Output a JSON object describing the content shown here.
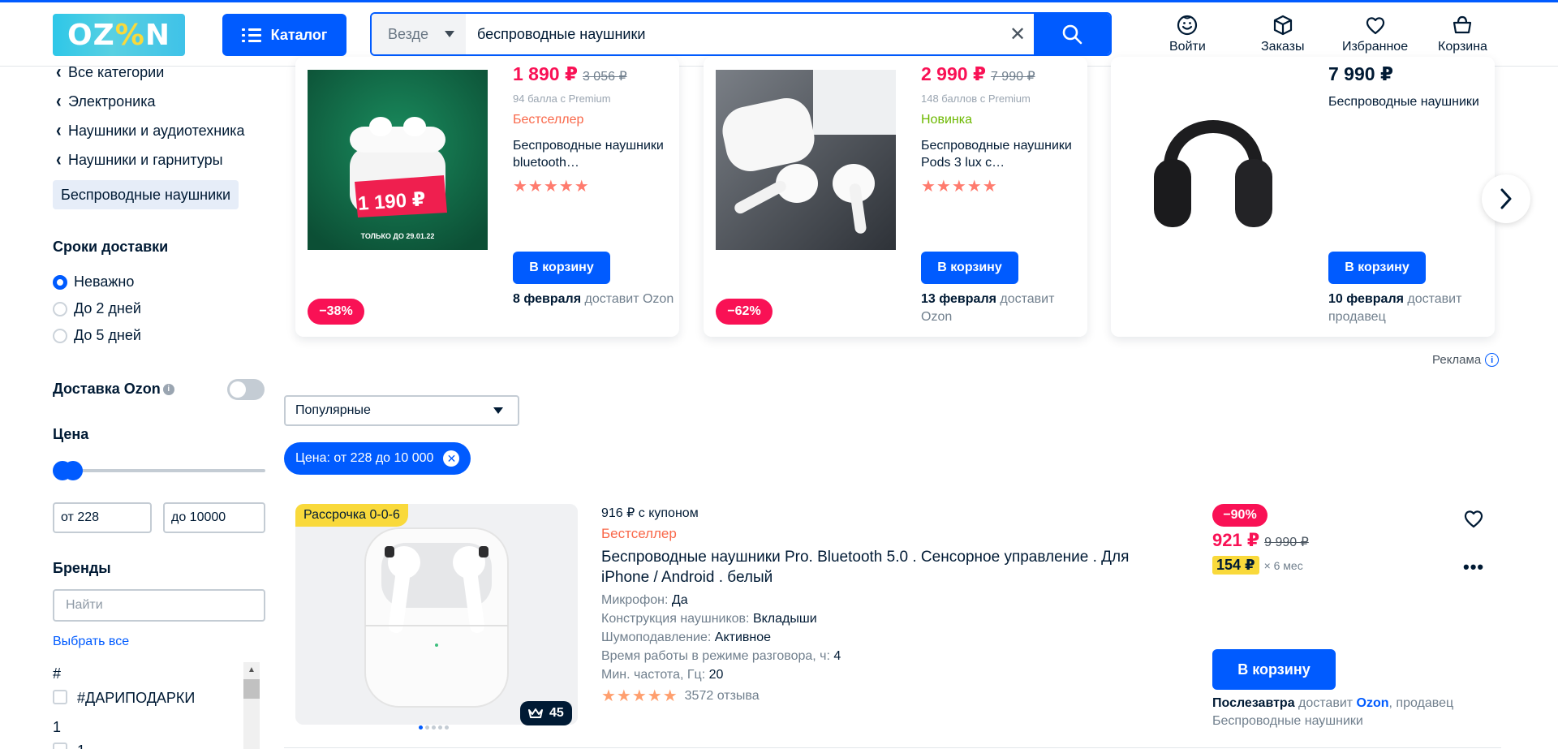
{
  "header": {
    "logo": "OZ%N",
    "catalog_label": "Каталог",
    "search_scope": "Везде",
    "search_query": "беспроводные наушники",
    "clear_symbol": "✕",
    "items": [
      {
        "label": "Войти",
        "icon": "user-face-icon"
      },
      {
        "label": "Заказы",
        "icon": "box-icon"
      },
      {
        "label": "Избранное",
        "icon": "heart-icon"
      },
      {
        "label": "Корзина",
        "icon": "basket-icon"
      }
    ]
  },
  "sidebar": {
    "breadcrumbs": [
      "Все категории",
      "Электроника",
      "Наушники и аудиотехника",
      "Наушники и гарнитуры"
    ],
    "current_category": "Беспроводные наушники",
    "delivery_title": "Сроки доставки",
    "delivery_options": [
      {
        "label": "Неважно",
        "selected": true
      },
      {
        "label": "До 2 дней",
        "selected": false
      },
      {
        "label": "До 5 дней",
        "selected": false
      }
    ],
    "ozon_delivery_label": "Доставка Ozon",
    "ozon_delivery_enabled": false,
    "price_title": "Цена",
    "price_from": "от 228",
    "price_to": "до 10000",
    "brands_title": "Бренды",
    "brands_search_placeholder": "Найти",
    "select_all": "Выбрать все",
    "brand_groups": [
      {
        "letter": "#",
        "items": [
          "#ДАРИПОДАРКИ"
        ]
      },
      {
        "letter": "1",
        "items": [
          "1"
        ]
      }
    ]
  },
  "ads": [
    {
      "price": "1 890 ₽",
      "old_price": "3 056 ₽",
      "points": "94 балла с Premium",
      "badge": "Бестселлер",
      "badge_color": "#f9684a",
      "title": "Беспроводные наушники bluetooth…",
      "rating": 5,
      "stars": "★★★★★",
      "cart": "В корзину",
      "delivery_date": "8 февраля",
      "delivery_rest": " доставит Ozon",
      "discount": "−38%",
      "image_price": "1 190 ₽",
      "image_caption": "ТОЛЬКО ДО 29.01.22"
    },
    {
      "price": "2 990 ₽",
      "old_price": "7 990 ₽",
      "points": "148 баллов с Premium",
      "badge": "Новинка",
      "badge_color": "#6cb800",
      "title": "Беспроводные наушники Pods 3 lux с…",
      "rating": 5,
      "stars": "★★★★★",
      "cart": "В корзину",
      "delivery_date": "13 февраля",
      "delivery_rest": " доставит Ozon",
      "discount": "−62%"
    },
    {
      "price": "7 990 ₽",
      "title": "Беспроводные наушники",
      "cart": "В корзину",
      "delivery_date": "10 февраля",
      "delivery_rest": " доставит продавец"
    }
  ],
  "ads_label": "Реклама",
  "sort": {
    "selected": "Популярные"
  },
  "active_filter": "Цена: от 228 до 10 000",
  "product": {
    "installment_badge": "Рассрочка 0-0-6",
    "premium_count": "45",
    "coupon": "916 ₽ с купоном",
    "badge": "Бестселлер",
    "title": "Беспроводные наушники Pro. Bluetooth 5.0 . Сенсорное управление . Для iPhone / Android . белый",
    "attributes": [
      {
        "name": "Микрофон: ",
        "value": "Да"
      },
      {
        "name": "Конструкция наушников: ",
        "value": "Вкладыши"
      },
      {
        "name": "Шумоподавление: ",
        "value": "Активное"
      },
      {
        "name": "Время работы в режиме разговора, ч: ",
        "value": "4"
      },
      {
        "name": "Мин. частота, Гц: ",
        "value": "20"
      }
    ],
    "rating": 4.5,
    "stars": "★★★★★",
    "reviews": "3572 отзыва",
    "discount": "−90%",
    "price": "921 ₽",
    "old_price": "9 990 ₽",
    "installment_price": "154 ₽",
    "installment_term": "× 6 мес",
    "cart": "В корзину",
    "delivery_date": "Послезавтра",
    "delivery_mid": " доставит ",
    "delivery_ozon": "Ozon",
    "delivery_rest": ", продавец Беспроводные наушники",
    "image_count": 5
  },
  "colors": {
    "brand_blue": "#005bff",
    "price_red": "#f91155",
    "bestseller": "#f9684a",
    "new_green": "#6cb800",
    "installment_yellow": "#f9d93b"
  }
}
